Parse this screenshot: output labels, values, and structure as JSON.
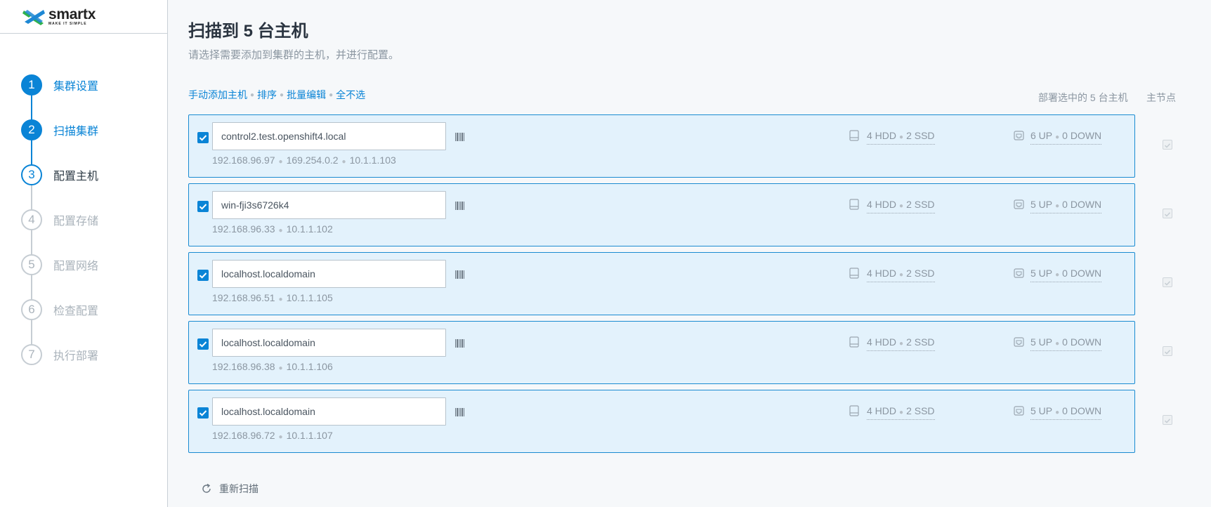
{
  "brand": {
    "name": "smartx",
    "tagline": "MAKE IT SIMPLE"
  },
  "steps": [
    {
      "num": "1",
      "label": "集群设置",
      "state": "done"
    },
    {
      "num": "2",
      "label": "扫描集群",
      "state": "done"
    },
    {
      "num": "3",
      "label": "配置主机",
      "state": "current"
    },
    {
      "num": "4",
      "label": "配置存储",
      "state": "pending"
    },
    {
      "num": "5",
      "label": "配置网络",
      "state": "pending"
    },
    {
      "num": "6",
      "label": "检查配置",
      "state": "pending"
    },
    {
      "num": "7",
      "label": "执行部署",
      "state": "pending"
    }
  ],
  "page": {
    "title": "扫描到 5 台主机",
    "subtitle": "请选择需要添加到集群的主机，并进行配置。"
  },
  "actions": {
    "add_manual": "手动添加主机",
    "sort": "排序",
    "batch_edit": "批量编辑",
    "deselect_all": "全不选"
  },
  "columns": {
    "deploy": "部署选中的 5 台主机",
    "master": "主节点"
  },
  "hosts": [
    {
      "hostname": "control2.test.openshift4.local",
      "ips": [
        "192.168.96.97",
        "169.254.0.2",
        "10.1.1.103"
      ],
      "hdd": "4 HDD",
      "ssd": "2 SSD",
      "up": "6 UP",
      "down": "0 DOWN",
      "checked": true
    },
    {
      "hostname": "win-fji3s6726k4",
      "ips": [
        "192.168.96.33",
        "10.1.1.102"
      ],
      "hdd": "4 HDD",
      "ssd": "2 SSD",
      "up": "5 UP",
      "down": "0 DOWN",
      "checked": true
    },
    {
      "hostname": "localhost.localdomain",
      "ips": [
        "192.168.96.51",
        "10.1.1.105"
      ],
      "hdd": "4 HDD",
      "ssd": "2 SSD",
      "up": "5 UP",
      "down": "0 DOWN",
      "checked": true
    },
    {
      "hostname": "localhost.localdomain",
      "ips": [
        "192.168.96.38",
        "10.1.1.106"
      ],
      "hdd": "4 HDD",
      "ssd": "2 SSD",
      "up": "5 UP",
      "down": "0 DOWN",
      "checked": true
    },
    {
      "hostname": "localhost.localdomain",
      "ips": [
        "192.168.96.72",
        "10.1.1.107"
      ],
      "hdd": "4 HDD",
      "ssd": "2 SSD",
      "up": "5 UP",
      "down": "0 DOWN",
      "checked": true
    }
  ],
  "rescan_label": "重新扫描",
  "colors": {
    "accent": "#0a84d6",
    "card_bg": "#e3f2fc",
    "card_border": "#1a8bd1",
    "muted": "#8b96a1"
  },
  "icons": {
    "checkbox": "checkbox-checked-icon",
    "barcode": "barcode-icon",
    "disk": "disk-icon",
    "network": "network-port-icon",
    "rescan": "refresh-icon"
  }
}
